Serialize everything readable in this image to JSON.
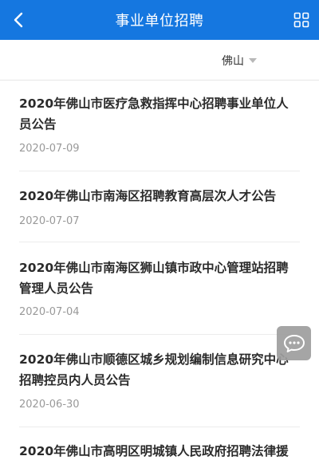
{
  "header": {
    "title": "事业单位招聘"
  },
  "filter": {
    "city": "佛山"
  },
  "articles": [
    {
      "title": "2020年佛山市医疗急救指挥中心招聘事业单位人员公告",
      "date": "2020-07-09"
    },
    {
      "title": "2020年佛山市南海区招聘教育高层次人才公告",
      "date": "2020-07-07"
    },
    {
      "title": "2020年佛山市南海区狮山镇市政中心管理站招聘管理人员公告",
      "date": "2020-07-04"
    },
    {
      "title": "2020年佛山市顺德区城乡规划编制信息研究中心招聘控员内人员公告",
      "date": "2020-06-30"
    },
    {
      "title": "2020年佛山市高明区明城镇人民政府招聘法律援",
      "date": ""
    }
  ],
  "icons": {
    "back": "chevron-left-icon",
    "grid": "grid-icon",
    "chat": "chat-bubble-icon"
  },
  "colors": {
    "header_bg": "#1577e0",
    "chat_bg": "#9e9e9e"
  }
}
